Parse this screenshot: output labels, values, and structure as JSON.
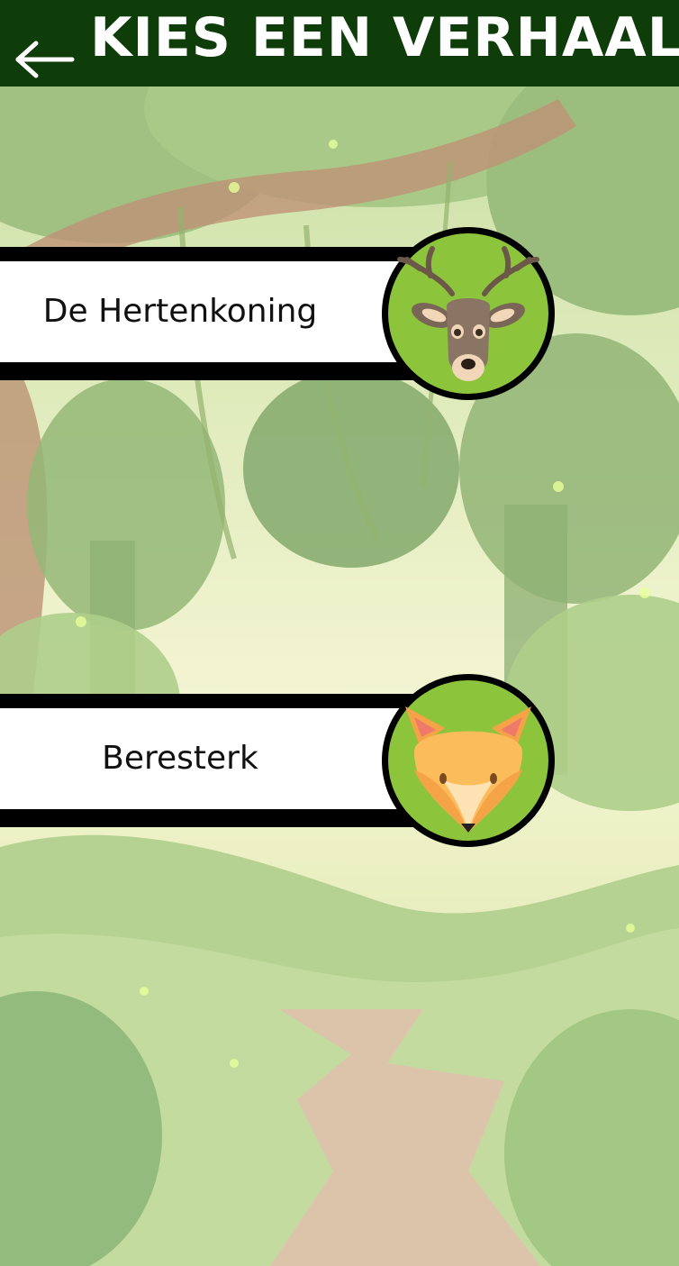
{
  "header": {
    "title": "KIES EEN VERHAAL",
    "back_icon": "arrow-left-icon"
  },
  "stories": [
    {
      "label": "De Hertenkoning",
      "icon": "deer-icon"
    },
    {
      "label": "Beresterk",
      "icon": "fox-icon"
    }
  ],
  "colors": {
    "header_bg": "#0f3d0a",
    "icon_bg": "#8cc43c"
  }
}
